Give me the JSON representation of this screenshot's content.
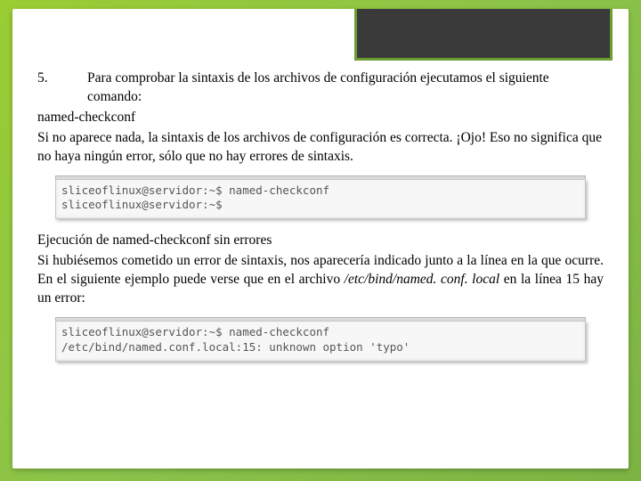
{
  "step_number": "5.",
  "para1": "Para comprobar la sintaxis de los archivos de configuración ejecutamos el siguiente comando:",
  "command": "named-checkconf",
  "para2": "Si no aparece nada, la sintaxis de los archivos de configuración es correcta. ¡Ojo! Eso no significa que no haya ningún error, sólo que no hay errores de sintaxis.",
  "terminal1": {
    "line1": "sliceoflinux@servidor:~$ named-checkconf",
    "line2": "sliceoflinux@servidor:~$"
  },
  "caption": "Ejecución de named-checkconf sin errores",
  "para3_a": "Si hubiésemos cometido un error de sintaxis, nos aparecería indicado junto a la línea en la que ocurre. En el siguiente ejemplo puede verse que en el archivo ",
  "para3_file": "/etc/bind/named. conf. local",
  "para3_b": " en la línea 15 hay un error:",
  "terminal2": {
    "line1": "sliceoflinux@servidor:~$ named-checkconf",
    "line2": "/etc/bind/named.conf.local:15: unknown option 'typo'"
  }
}
